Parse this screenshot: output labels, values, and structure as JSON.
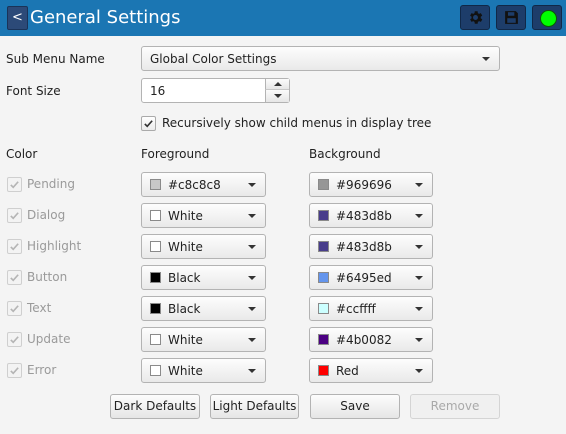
{
  "window": {
    "title": "General Settings",
    "back_label": "<"
  },
  "toolbar": {
    "status_color": "#00ff00"
  },
  "sub_menu": {
    "label": "Sub Menu Name",
    "value": "Global Color Settings"
  },
  "font_size": {
    "label": "Font Size",
    "value": "16"
  },
  "recursive": {
    "label": "Recursively show child menus in display tree",
    "checked": true
  },
  "columns": {
    "color": "Color",
    "foreground": "Foreground",
    "background": "Background"
  },
  "rows": [
    {
      "name": "Pending",
      "fg_label": "#c8c8c8",
      "fg_color": "#c8c8c8",
      "bg_label": "#969696",
      "bg_color": "#969696"
    },
    {
      "name": "Dialog",
      "fg_label": "White",
      "fg_color": "#ffffff",
      "bg_label": "#483d8b",
      "bg_color": "#483d8b"
    },
    {
      "name": "Highlight",
      "fg_label": "White",
      "fg_color": "#ffffff",
      "bg_label": "#483d8b",
      "bg_color": "#483d8b"
    },
    {
      "name": "Button",
      "fg_label": "Black",
      "fg_color": "#000000",
      "bg_label": "#6495ed",
      "bg_color": "#6495ed"
    },
    {
      "name": "Text",
      "fg_label": "Black",
      "fg_color": "#000000",
      "bg_label": "#ccffff",
      "bg_color": "#ccffff"
    },
    {
      "name": "Update",
      "fg_label": "White",
      "fg_color": "#ffffff",
      "bg_label": "#4b0082",
      "bg_color": "#4b0082"
    },
    {
      "name": "Error",
      "fg_label": "White",
      "fg_color": "#ffffff",
      "bg_label": "Red",
      "bg_color": "#ff0000"
    }
  ],
  "buttons": {
    "dark_defaults": "Dark Defaults",
    "light_defaults": "Light Defaults",
    "save": "Save",
    "remove": "Remove"
  }
}
